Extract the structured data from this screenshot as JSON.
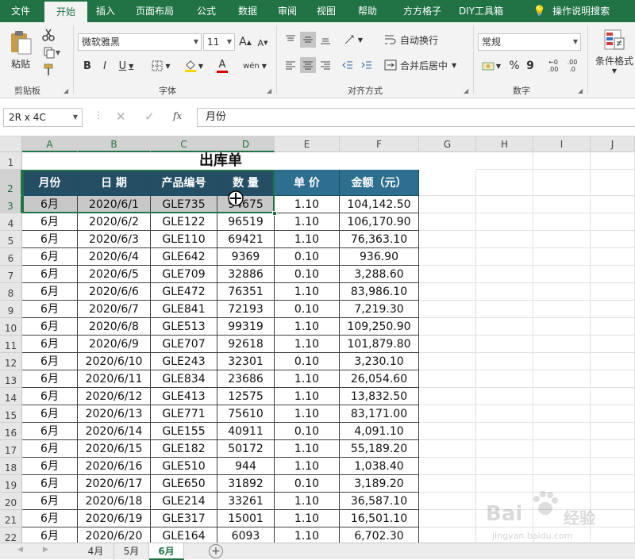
{
  "ribbon_tabs": [
    "文件",
    "开始",
    "插入",
    "页面布局",
    "公式",
    "数据",
    "审阅",
    "视图",
    "帮助",
    "方方格子",
    "DIY工具箱",
    "操作说明搜索"
  ],
  "active_tab": "开始",
  "ribbon": {
    "clipboard": {
      "paste_label": "粘贴",
      "group_label": "剪贴板"
    },
    "font": {
      "font_name": "微软雅黑",
      "font_size": "11",
      "bold": "B",
      "italic": "I",
      "underline": "U",
      "grow": "A",
      "shrink": "A",
      "font_color_glyph": "A",
      "phonetic": "wén",
      "group_label": "字体"
    },
    "alignment": {
      "wrap_text": "自动换行",
      "merge_center": "合并后居中",
      "group_label": "对齐方式"
    },
    "number": {
      "format": "常规",
      "percent": "%",
      "comma": "9",
      "inc_decimal": ".00",
      "dec_decimal": ".0",
      "group_label": "数字"
    },
    "styles": {
      "conditional_format": "条件格式"
    }
  },
  "formula_bar": {
    "name_box": "2R x 4C",
    "fx": "fx",
    "content": "月份"
  },
  "columns": [
    "A",
    "B",
    "C",
    "D",
    "E",
    "F",
    "G",
    "H",
    "I",
    "J"
  ],
  "row_numbers": [
    "1",
    "2",
    "3",
    "4",
    "5",
    "6",
    "7",
    "8",
    "9",
    "10",
    "11",
    "12",
    "13",
    "14",
    "15",
    "16",
    "17",
    "18",
    "19",
    "20",
    "21",
    "22"
  ],
  "table": {
    "title": "出库单",
    "headers": [
      "月份",
      "日 期",
      "产品编号",
      "数  量",
      "单  价",
      "金额（元）"
    ],
    "rows": [
      [
        "6月",
        "2020/6/1",
        "GLE735",
        "94675",
        "1.10",
        "104,142.50"
      ],
      [
        "6月",
        "2020/6/2",
        "GLE122",
        "96519",
        "1.10",
        "106,170.90"
      ],
      [
        "6月",
        "2020/6/3",
        "GLE110",
        "69421",
        "1.10",
        "76,363.10"
      ],
      [
        "6月",
        "2020/6/4",
        "GLE642",
        "9369",
        "0.10",
        "936.90"
      ],
      [
        "6月",
        "2020/6/5",
        "GLE709",
        "32886",
        "0.10",
        "3,288.60"
      ],
      [
        "6月",
        "2020/6/6",
        "GLE472",
        "76351",
        "1.10",
        "83,986.10"
      ],
      [
        "6月",
        "2020/6/7",
        "GLE841",
        "72193",
        "0.10",
        "7,219.30"
      ],
      [
        "6月",
        "2020/6/8",
        "GLE513",
        "99319",
        "1.10",
        "109,250.90"
      ],
      [
        "6月",
        "2020/6/9",
        "GLE707",
        "92618",
        "1.10",
        "101,879.80"
      ],
      [
        "6月",
        "2020/6/10",
        "GLE243",
        "32301",
        "0.10",
        "3,230.10"
      ],
      [
        "6月",
        "2020/6/11",
        "GLE834",
        "23686",
        "1.10",
        "26,054.60"
      ],
      [
        "6月",
        "2020/6/12",
        "GLE413",
        "12575",
        "1.10",
        "13,832.50"
      ],
      [
        "6月",
        "2020/6/13",
        "GLE771",
        "75610",
        "1.10",
        "83,171.00"
      ],
      [
        "6月",
        "2020/6/14",
        "GLE155",
        "40911",
        "0.10",
        "4,091.10"
      ],
      [
        "6月",
        "2020/6/15",
        "GLE182",
        "50172",
        "1.10",
        "55,189.20"
      ],
      [
        "6月",
        "2020/6/16",
        "GLE510",
        "944",
        "1.10",
        "1,038.40"
      ],
      [
        "6月",
        "2020/6/17",
        "GLE650",
        "31892",
        "0.10",
        "3,189.20"
      ],
      [
        "6月",
        "2020/6/18",
        "GLE214",
        "33261",
        "1.10",
        "36,587.10"
      ],
      [
        "6月",
        "2020/6/19",
        "GLE317",
        "15001",
        "1.10",
        "16,501.10"
      ],
      [
        "6月",
        "2020/6/20",
        "GLE164",
        "6093",
        "1.10",
        "6,702.30"
      ]
    ]
  },
  "sheet_tabs": [
    "4月",
    "5月",
    "6月"
  ],
  "active_sheet": "6月",
  "watermark": {
    "brand": "Bai",
    "brand2": "经验",
    "url": "jingyan.baidu.com"
  },
  "colors": {
    "accent": "#217346",
    "header_fill": "#2e6e8e"
  }
}
